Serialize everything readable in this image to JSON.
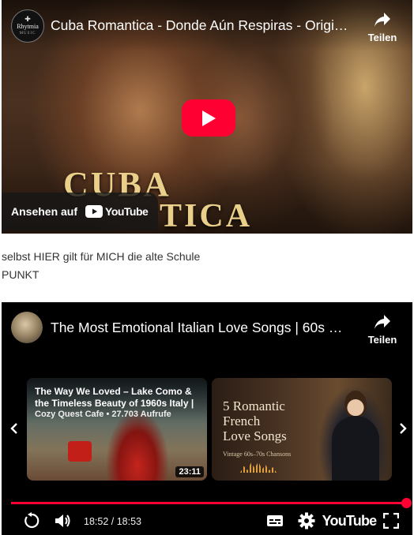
{
  "video1": {
    "channel_logo": {
      "name": "Rhytmia",
      "sub": "MUSIC",
      "mark": "✚"
    },
    "title": "Cuba Romantica - Donde Aún Respiras - Original",
    "share_label": "Teilen",
    "poster_text_line1": "CUBA",
    "poster_text_line2": "TICA",
    "watch_on_label": "Ansehen auf",
    "youtube_word": "YouTube"
  },
  "article": {
    "line1": "selbst HIER gilt für MICH die alte Schule",
    "line2": "PUNKT"
  },
  "video2": {
    "title": "The Most Emotional Italian Love Songs | 60s Ballads",
    "share_label": "Teilen",
    "related": [
      {
        "title": "The Way We Loved – Lake Como & the Timeless Beauty of 1960s Italy |",
        "meta": "Cozy Quest Cafe • 27.703 Aufrufe",
        "duration": "23:11"
      },
      {
        "title_lines": [
          "5 Romantic",
          "French",
          "Love Songs"
        ],
        "subtitle": "Vintage 60s–70s Chansons"
      }
    ],
    "progress": 1.0,
    "time_display": "18:52 / 18:53",
    "youtube_word": "YouTube",
    "accent_color": "#ff0033"
  }
}
